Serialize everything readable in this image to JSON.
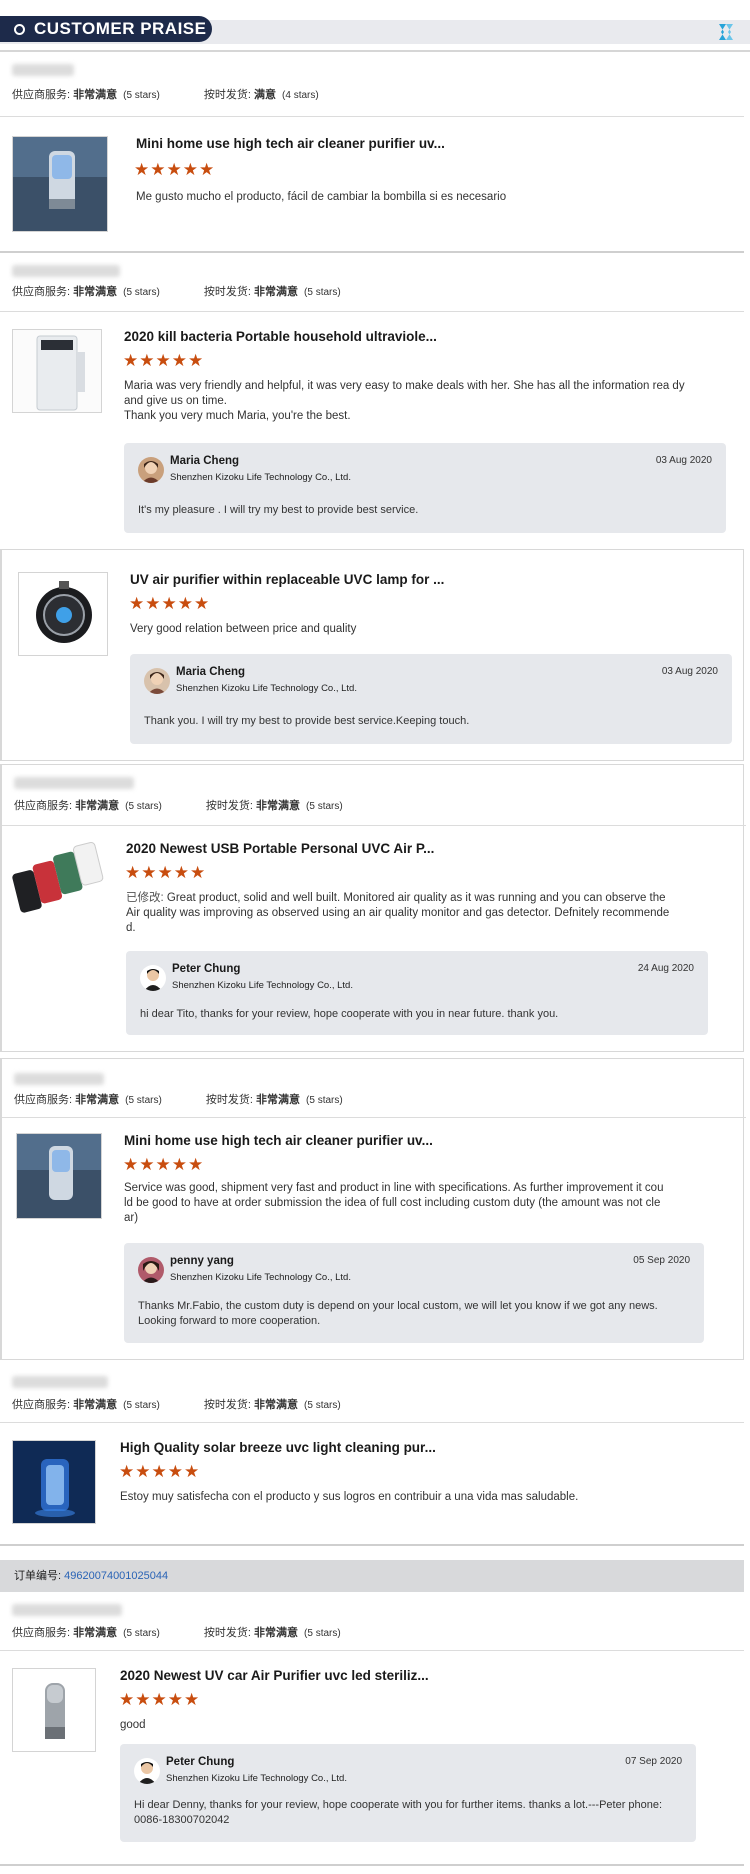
{
  "header": {
    "title": "CUSTOMER PRAISE"
  },
  "labels": {
    "supplier_service": "供应商服务:",
    "on_time_delivery": "按时发货:",
    "very_satisfied": "非常满意",
    "satisfied": "满意",
    "five_stars": "(5 stars)",
    "four_stars": "(4 stars)",
    "modified_prefix": "已修改:",
    "order_label": "订单编号:"
  },
  "colors": {
    "header_bg": "#1d2a4a",
    "star": "#c84d0f",
    "reply_bg": "#e6e8ec",
    "order_link": "#2a64b6"
  },
  "reviews": [
    {
      "product_title": "Mini home use high tech air cleaner purifier uv...",
      "stars": "★★★★★",
      "text": "Me gusto mucho el producto, fácil de cambiar la bombilla si es necesario",
      "delivery_value": "满意",
      "delivery_stars": "(4 stars)"
    },
    {
      "product_title": "2020 kill bacteria Portable household ultraviole...",
      "stars": "★★★★★",
      "text": "Maria was very friendly and helpful, it was very easy to make deals with her. She has all the information rea dy and give us on time.\nThank you very much Maria, you're the best.",
      "reply": {
        "name": "Maria Cheng",
        "company": "Shenzhen Kizoku Life Technology Co., Ltd.",
        "date": "03 Aug 2020",
        "message": "It's my pleasure . I will try my best to provide best service."
      }
    },
    {
      "product_title": "UV air purifier within replaceable UVC lamp for ...",
      "stars": "★★★★★",
      "text": "Very good relation between price and quality",
      "reply": {
        "name": "Maria Cheng",
        "company": "Shenzhen Kizoku Life Technology Co., Ltd.",
        "date": "03 Aug 2020",
        "message": "Thank you. I will try my best to provide best service.Keeping touch."
      }
    },
    {
      "product_title": "2020 Newest USB Portable Personal UVC Air P...",
      "stars": "★★★★★",
      "text": "Great product, solid and well built. Monitored air quality as it was running and you can observe the Air quality was improving as observed using an air quality monitor and gas detector. Defnitely recommende d.",
      "reply": {
        "name": "Peter Chung",
        "company": "Shenzhen Kizoku Life Technology Co., Ltd.",
        "date": "24 Aug 2020",
        "message": "hi dear Tito, thanks for your review, hope cooperate with you in near future. thank you."
      }
    },
    {
      "product_title": "Mini home use high tech air cleaner purifier uv...",
      "stars": "★★★★★",
      "text": "Service was good, shipment very fast and product in line with specifications. As further improvement it cou ld be good to have at order submission the idea of full cost including custom duty (the amount was not cle ar)",
      "reply": {
        "name": "penny yang",
        "company": "Shenzhen Kizoku Life Technology Co., Ltd.",
        "date": "05 Sep 2020",
        "message": "Thanks Mr.Fabio,  the custom duty is depend on your local custom, we will let you know if we got any news. Looking forward to more cooperation."
      }
    },
    {
      "product_title": "High Quality solar breeze uvc light cleaning pur...",
      "stars": "★★★★★",
      "text": "Estoy muy satisfecha con el producto y sus logros en contribuir a una vida mas saludable."
    },
    {
      "product_title": "2020 Newest UV car Air Purifier uvc led steriliz...",
      "stars": "★★★★★",
      "text": "good",
      "reply": {
        "name": "Peter Chung",
        "company": "Shenzhen Kizoku Life Technology Co., Ltd.",
        "date": "07 Sep 2020",
        "message": "Hi dear Denny, thanks for your review, hope cooperate with you for further items. thanks a lot.---Peter phone: 0086-18300702042"
      }
    }
  ],
  "order": {
    "number": "49620074001025044"
  }
}
